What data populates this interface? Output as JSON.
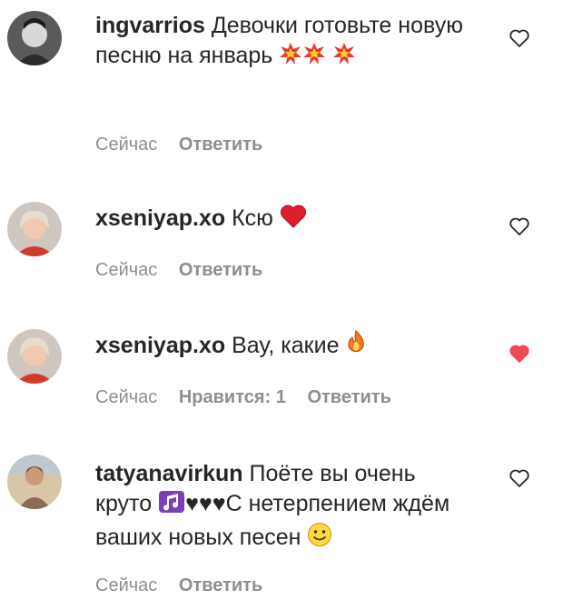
{
  "colors": {
    "like_red": "#ed4956",
    "meta_gray": "#8e8e8e",
    "text": "#262626"
  },
  "comments": [
    {
      "username": "ingvarrios",
      "text": "Девочки готовьте новую песню на январь",
      "emojis": [
        "collision-emoji",
        "collision-emoji",
        "collision-emoji"
      ],
      "time": "Сейчас",
      "likes": "",
      "reply": "Ответить",
      "liked": false
    },
    {
      "username": "xseniyap.xo",
      "text": "Ксю",
      "emojis": [
        "red-heart-emoji"
      ],
      "time": "Сейчас",
      "likes": "",
      "reply": "Ответить",
      "liked": false
    },
    {
      "username": "xseniyap.xo",
      "text": "Вау, какие",
      "emojis": [
        "fire-emoji"
      ],
      "time": "Сейчас",
      "likes": "Нравится: 1",
      "reply": "Ответить",
      "liked": true
    },
    {
      "username": "tatyanavirkun",
      "text_part1": "Поёте вы очень круто",
      "text_part2": "♥♥♥С нетерпением ждём ваших новых песен",
      "emojis": [
        "music-notes-emoji",
        "smiley-emoji"
      ],
      "time": "Сейчас",
      "likes": "",
      "reply": "Ответить",
      "liked": false
    }
  ]
}
